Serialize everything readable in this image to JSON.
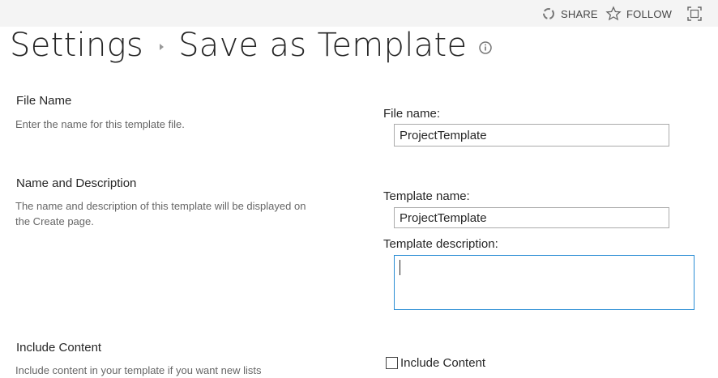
{
  "topbar": {
    "share_label": "SHARE",
    "follow_label": "FOLLOW",
    "share_icon": "share-icon",
    "follow_icon": "star-icon",
    "focus_icon": "focus-mode-icon"
  },
  "title": {
    "parent": "Settings",
    "current": "Save as Template"
  },
  "sections": {
    "file_name": {
      "title": "File Name",
      "description": "Enter the name for this template file.",
      "field_label": "File name:",
      "field_value": "ProjectTemplate"
    },
    "name_description": {
      "title": "Name and Description",
      "description": "The name and description of this template will be displayed on the Create page.",
      "name_label": "Template name:",
      "name_value": "ProjectTemplate",
      "description_label": "Template description:",
      "description_value": ""
    },
    "include_content": {
      "title": "Include Content",
      "description": "Include content in your template if you want new lists",
      "checkbox_label": "Include Content",
      "checked": false
    }
  },
  "colors": {
    "accent": "#2a8dd4",
    "topbar_bg": "#f4f4f4",
    "text": "#262626",
    "muted": "#666666"
  }
}
